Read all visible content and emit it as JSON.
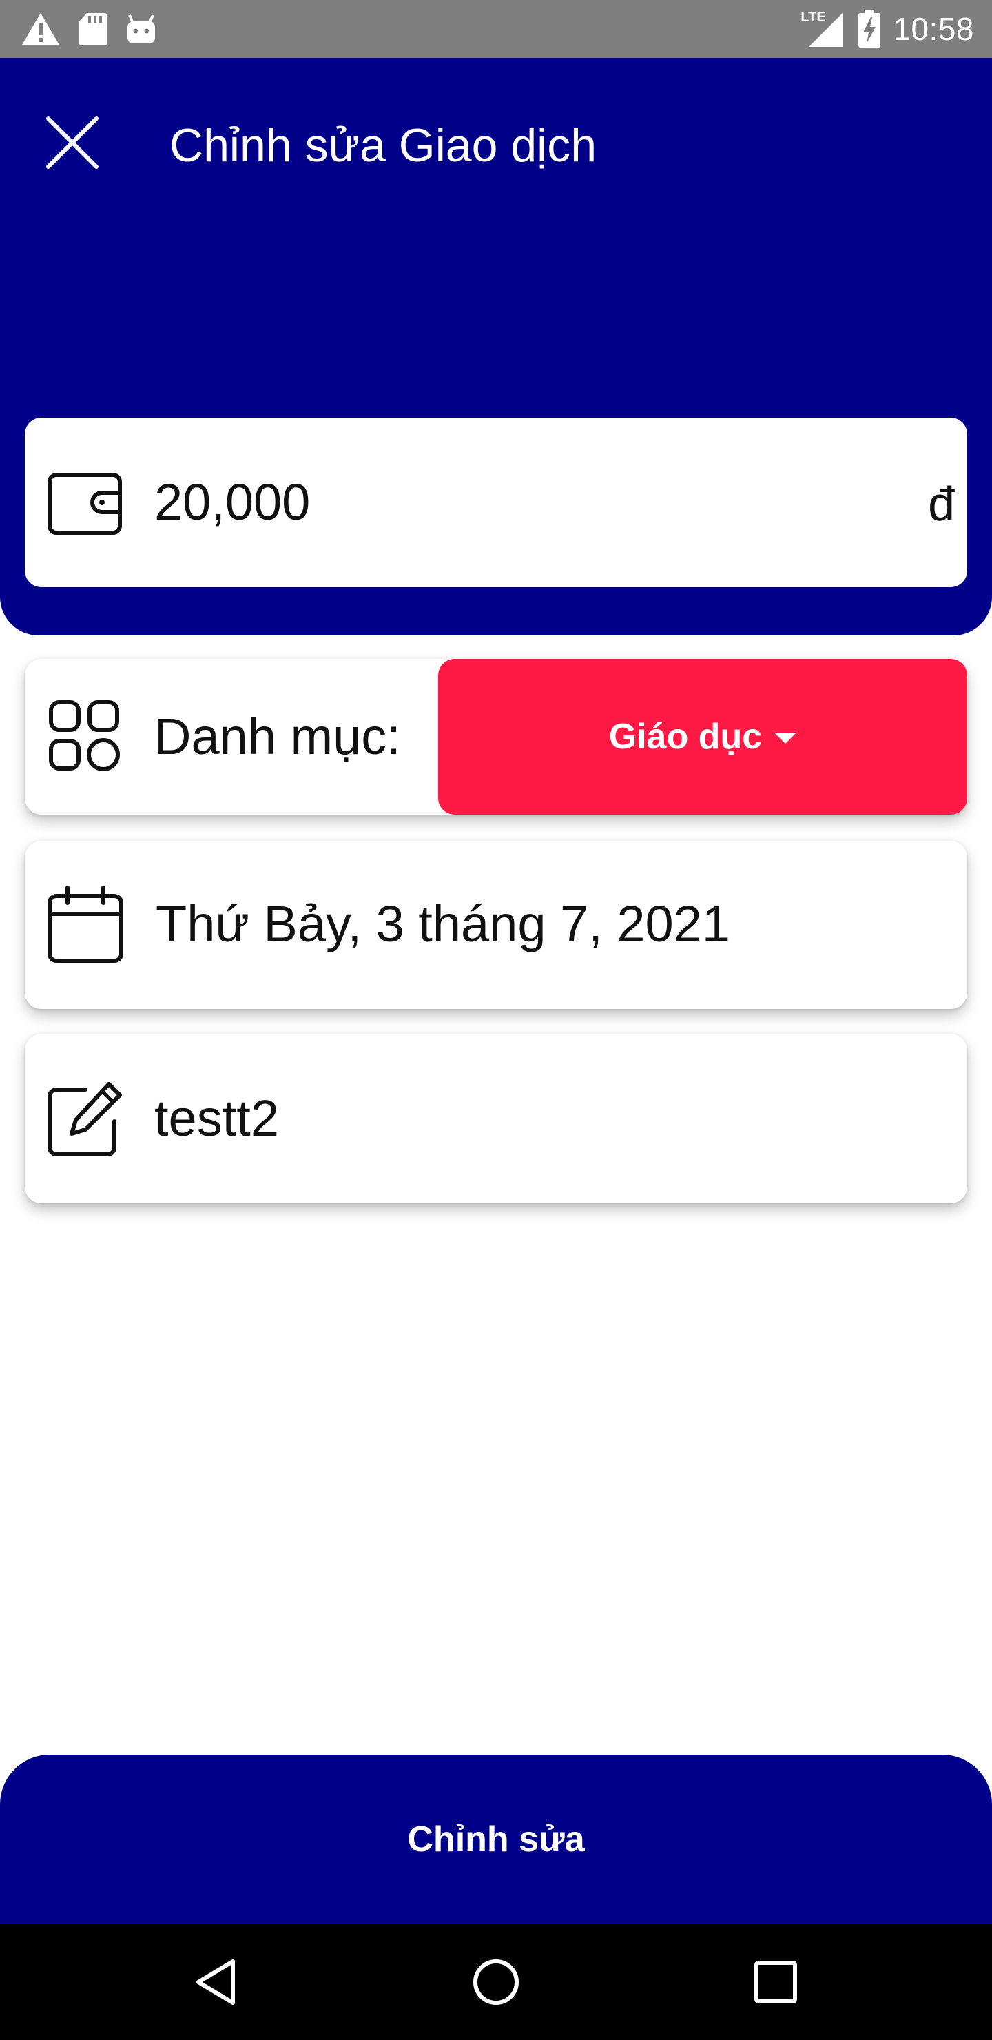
{
  "status_bar": {
    "time": "10:58",
    "network": "LTE",
    "icons": [
      "warning-icon",
      "sd-card-icon",
      "android-icon",
      "signal-icon",
      "battery-charging-icon"
    ]
  },
  "header": {
    "title": "Chỉnh sửa Giao dịch",
    "close_icon": "close-icon"
  },
  "amount": {
    "value": "20,000",
    "currency": "đ",
    "icon": "wallet-icon"
  },
  "category": {
    "label": "Danh mục:",
    "selected": "Giáo dục",
    "icon": "grid-icon"
  },
  "date": {
    "value": "Thứ Bảy, 3 tháng 7, 2021",
    "icon": "calendar-icon"
  },
  "note": {
    "value": "testt2",
    "icon": "edit-icon"
  },
  "submit": {
    "label": "Chỉnh sửa"
  },
  "nav": {
    "back_icon": "back-icon",
    "home_icon": "home-icon",
    "recents_icon": "recents-icon"
  },
  "colors": {
    "primary": "#000088",
    "accent": "#ff1a46",
    "status_bar": "#7f7f7f"
  }
}
